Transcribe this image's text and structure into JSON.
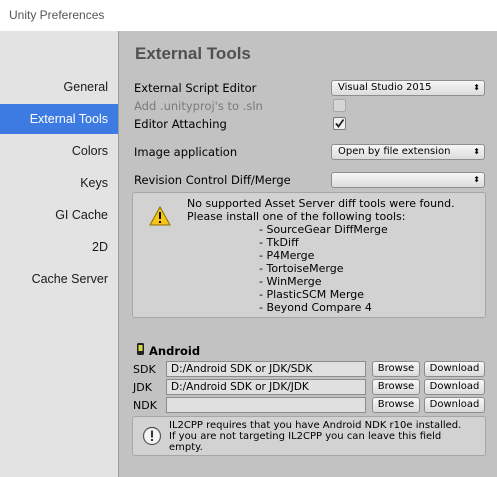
{
  "window": {
    "title": "Unity Preferences"
  },
  "sidebar": {
    "items": [
      {
        "label": "General",
        "selected": false
      },
      {
        "label": "External Tools",
        "selected": true
      },
      {
        "label": "Colors",
        "selected": false
      },
      {
        "label": "Keys",
        "selected": false
      },
      {
        "label": "GI Cache",
        "selected": false
      },
      {
        "label": "2D",
        "selected": false
      },
      {
        "label": "Cache Server",
        "selected": false
      }
    ]
  },
  "main": {
    "heading": "External Tools",
    "external_script_editor": {
      "label": "External Script Editor",
      "value": "Visual Studio 2015"
    },
    "add_unityproj": {
      "label": "Add .unityproj's to .sln",
      "checked": false,
      "disabled": true
    },
    "editor_attaching": {
      "label": "Editor Attaching",
      "checked": true
    },
    "image_application": {
      "label": "Image application",
      "value": "Open by file extension"
    },
    "revision_control": {
      "label": "Revision Control Diff/Merge",
      "value": ""
    },
    "warning": {
      "message": "No supported Asset Server diff tools were found.\nPlease install one of the following tools:",
      "tools": [
        "- SourceGear DiffMerge",
        "- TkDiff",
        "- P4Merge",
        "- TortoiseMerge",
        "- WinMerge",
        "- PlasticSCM Merge",
        "- Beyond Compare 4"
      ]
    },
    "android": {
      "title": "Android",
      "rows": [
        {
          "label": "SDK",
          "value": "D:/Android SDK or JDK/SDK",
          "browse": "Browse",
          "download": "Download"
        },
        {
          "label": "JDK",
          "value": "D:/Android SDK or JDK/JDK",
          "browse": "Browse",
          "download": "Download"
        },
        {
          "label": "NDK",
          "value": "",
          "browse": "Browse",
          "download": "Download"
        }
      ],
      "info": "IL2CPP requires that you have Android NDK r10e installed.\nIf you are not targeting IL2CPP you can leave this field\nempty."
    }
  },
  "colors": {
    "selection": "#3d7be3",
    "sidebar_bg": "#e3e3e3",
    "panel_bg": "#c2c2c2"
  }
}
